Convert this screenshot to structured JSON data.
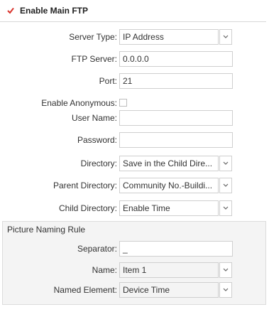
{
  "header": {
    "label": "Enable Main FTP",
    "checked": true,
    "check_color": "#d9322b"
  },
  "fields": {
    "server_type": {
      "label": "Server Type:",
      "value": "IP Address"
    },
    "ftp_server": {
      "label": "FTP Server:",
      "value": "0.0.0.0"
    },
    "port": {
      "label": "Port:",
      "value": "21"
    },
    "enable_anonymous": {
      "label": "Enable Anonymous:",
      "checked": false
    },
    "user_name": {
      "label": "User Name:",
      "value": ""
    },
    "password": {
      "label": "Password:",
      "value": ""
    },
    "directory": {
      "label": "Directory:",
      "value": "Save in the Child Dire..."
    },
    "parent_directory": {
      "label": "Parent Directory:",
      "value": "Community No.-Buildi..."
    },
    "child_directory": {
      "label": "Child Directory:",
      "value": "Enable Time"
    }
  },
  "picture_naming": {
    "title": "Picture Naming Rule",
    "separator": {
      "label": "Separator:",
      "value": "_"
    },
    "name": {
      "label": "Name:",
      "value": "Item 1"
    },
    "named_element": {
      "label": "Named Element:",
      "value": "Device Time"
    }
  },
  "icons": {
    "check": "checkmark-icon",
    "dropdown": "chevron-down-icon"
  }
}
